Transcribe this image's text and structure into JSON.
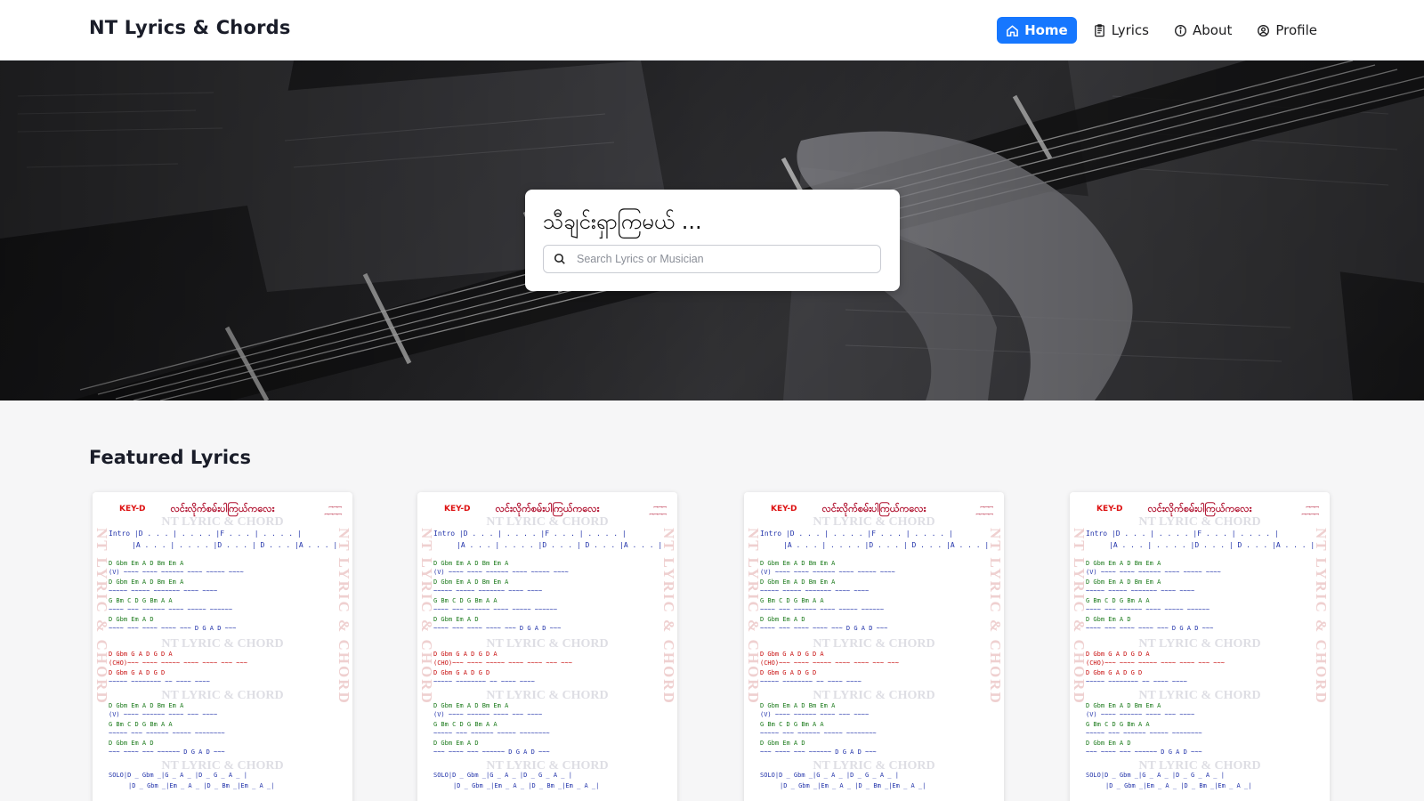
{
  "header": {
    "brand": "NT Lyrics & Chords",
    "nav": [
      {
        "label": "Home",
        "icon": "home-icon",
        "active": true
      },
      {
        "label": "Lyrics",
        "icon": "document-icon",
        "active": false
      },
      {
        "label": "About",
        "icon": "info-icon",
        "active": false
      },
      {
        "label": "Profile",
        "icon": "user-circle-icon",
        "active": false
      }
    ]
  },
  "hero": {
    "search_title": "သီချင်းရှာကြမယ် ...",
    "search_placeholder": "Search Lyrics or Musician"
  },
  "featured": {
    "title": "Featured Lyrics",
    "cards": [
      {
        "key": "KEY-D",
        "song_title": "လင်းလိုက်စမ်းပါကြယ်ကလေး",
        "watermark": "NT LYRIC & CHORD"
      },
      {
        "key": "KEY-D",
        "song_title": "လင်းလိုက်စမ်းပါကြယ်ကလေး",
        "watermark": "NT LYRIC & CHORD"
      },
      {
        "key": "KEY-D",
        "song_title": "လင်းလိုက်စမ်းပါကြယ်ကလေး",
        "watermark": "NT LYRIC & CHORD"
      },
      {
        "key": "KEY-D",
        "song_title": "လင်းလိုက်စမ်းပါကြယ်ကလေး",
        "watermark": "NT LYRIC & CHORD"
      }
    ]
  },
  "colors": {
    "accent": "#1677ff",
    "chord": "#1b7a1b",
    "lyric": "#2233aa",
    "chorus": "#c81010"
  }
}
